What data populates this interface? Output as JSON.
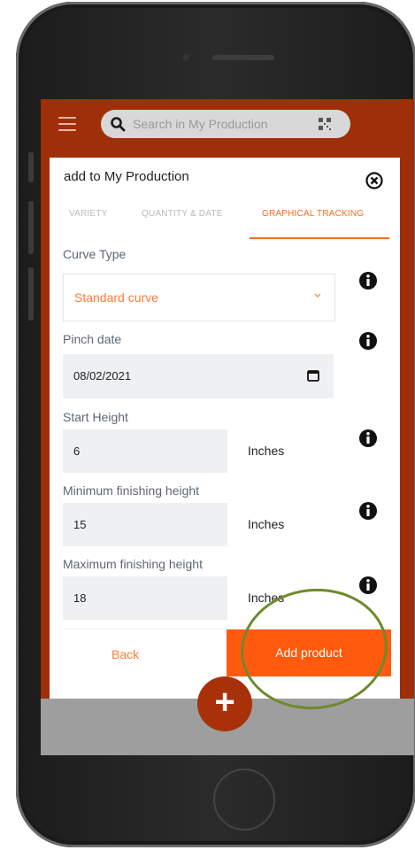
{
  "app": {
    "search_placeholder": "Search in My Production"
  },
  "dialog": {
    "title": "add to My Production",
    "tabs": [
      {
        "label": "VARIETY",
        "active": false
      },
      {
        "label": "QUANTITY & DATE",
        "active": false
      },
      {
        "label": "GRAPHICAL TRACKING",
        "active": true
      }
    ],
    "fields": {
      "curve_type": {
        "label": "Curve Type",
        "value": "Standard curve"
      },
      "pinch_date": {
        "label": "Pinch date",
        "value": "08/02/2021"
      },
      "start_height": {
        "label": "Start Height",
        "value": "6",
        "unit": "Inches"
      },
      "min_height": {
        "label": "Minimum finishing height",
        "value": "15",
        "unit": "Inches"
      },
      "max_height": {
        "label": "Maximum finishing height",
        "value": "18",
        "unit": "Inches"
      }
    },
    "back_label": "Back",
    "add_label": "Add product"
  },
  "fab": {
    "label": "+"
  },
  "colors": {
    "accent": "#ff5a0e",
    "header": "#9e2f08",
    "field_bg": "#eef0f2",
    "highlight_circle": "#6e8a2a"
  },
  "icons": [
    "menu-icon",
    "search-icon",
    "qr-code-icon",
    "close-icon",
    "info-icon",
    "chevron-down-icon",
    "calendar-icon",
    "plus-icon"
  ]
}
